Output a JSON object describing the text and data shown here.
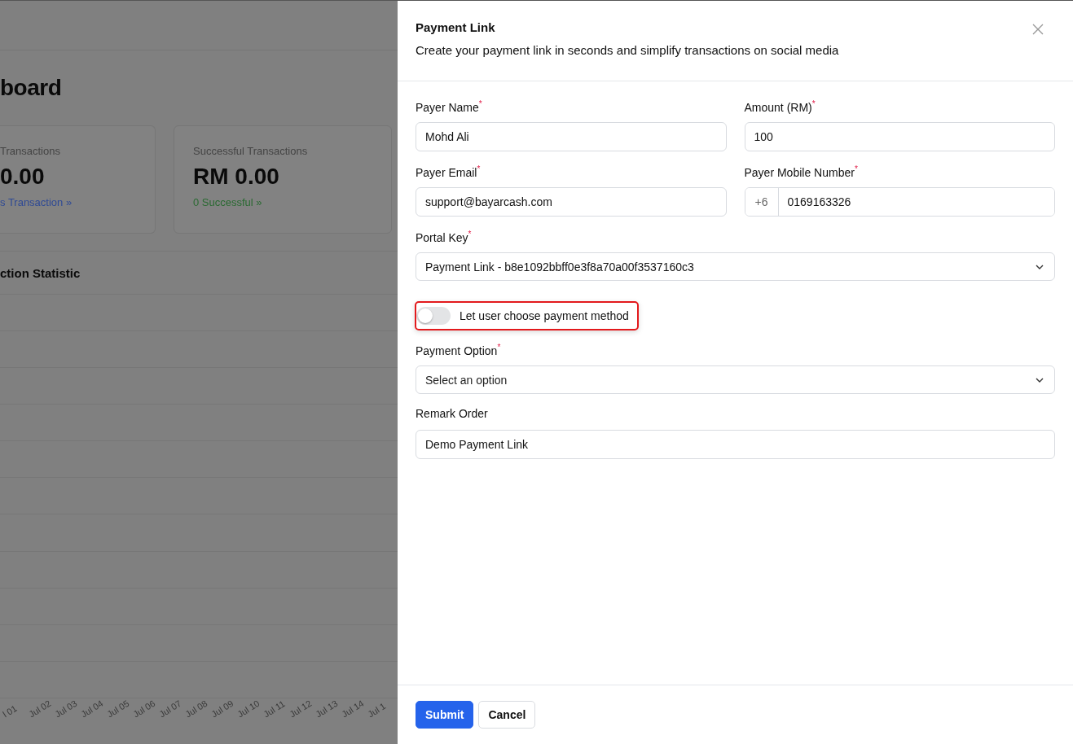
{
  "background": {
    "heading": "board",
    "cards": [
      {
        "label": "Transactions",
        "value": "0.00",
        "link": "s Transaction »",
        "kind": "blue"
      },
      {
        "label": "Successful Transactions",
        "value": "RM 0.00",
        "link": "0 Successful »",
        "kind": "green"
      }
    ],
    "chart_title": "ction Statistic",
    "x_labels": [
      "l 01",
      "Jul 02",
      "Jul 03",
      "Jul 04",
      "Jul 05",
      "Jul 06",
      "Jul 07",
      "Jul 08",
      "Jul 09",
      "Jul 10",
      "Jul 11",
      "Jul 12",
      "Jul 13",
      "Jul 14",
      "Jul 1"
    ]
  },
  "dialog": {
    "title": "Payment Link",
    "subtitle": "Create your payment link in seconds and simplify transactions on social media",
    "rows": [
      [
        {
          "label": "Payer Name",
          "required_mark": "*",
          "value": "Mohd Ali"
        },
        {
          "label": "Amount (RM)",
          "required_mark": "*",
          "value": "100"
        }
      ],
      [
        {
          "label": "Payer Email",
          "required_mark": "*",
          "value": "support@bayarcash.com"
        },
        {
          "label": "Payer Mobile Number",
          "required_mark": "*",
          "prefix": "+6",
          "value": "0169163326"
        }
      ]
    ],
    "portal_key": {
      "label": "Portal Key",
      "required_mark": "*",
      "value": "Payment Link - b8e1092bbff0e3f8a70a00f3537160c3"
    },
    "toggle": {
      "label": "Let user choose payment method",
      "on": false,
      "highlighted": true
    },
    "payment_option": {
      "label": "Payment Option",
      "required_mark": "*",
      "placeholder": "Select an option"
    },
    "remark": {
      "label": "Remark Order",
      "value": "Demo Payment Link"
    },
    "buttons": [
      {
        "label": "Submit",
        "kind": "primary"
      },
      {
        "label": "Cancel",
        "kind": "secondary"
      }
    ]
  }
}
